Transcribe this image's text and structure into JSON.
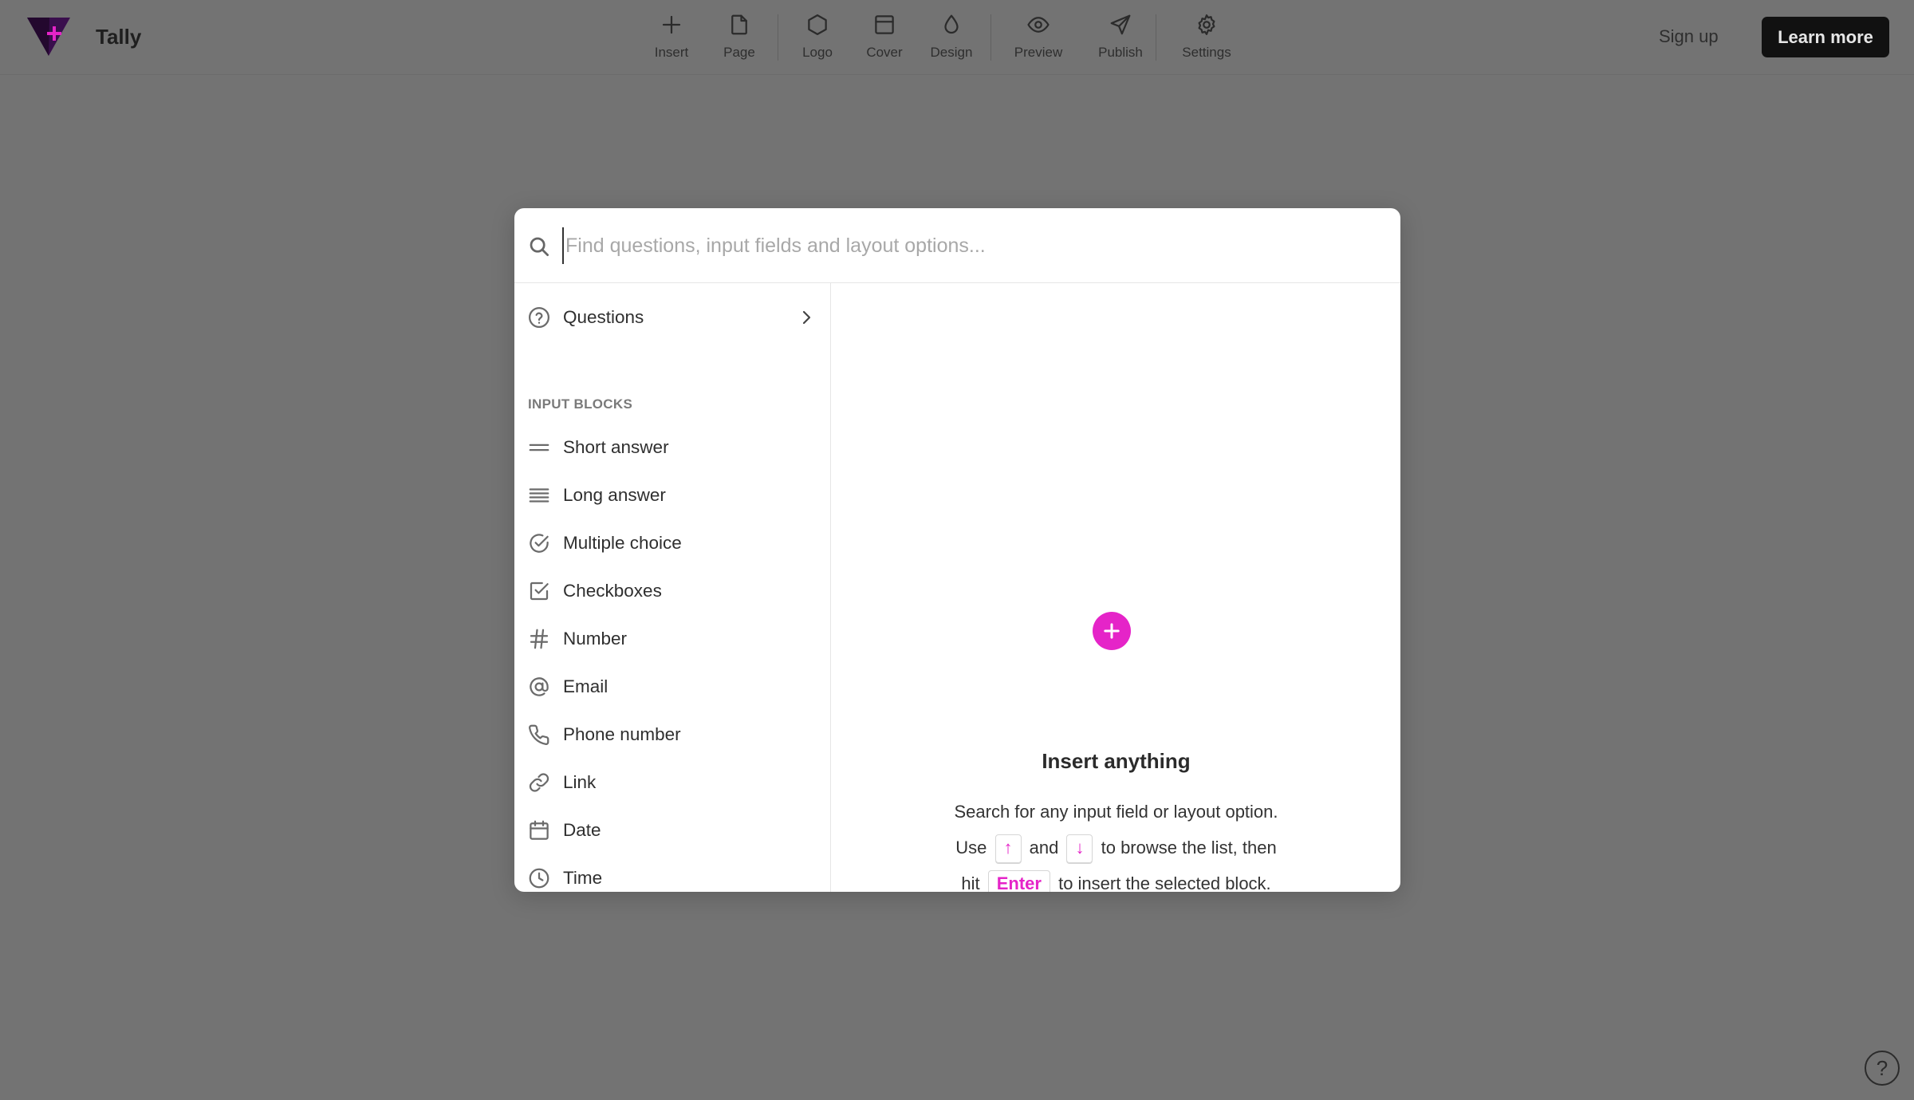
{
  "app": {
    "name": "Tally",
    "brand_colors": {
      "accent": "#e524c8",
      "logo_dark": "#3a0f4d"
    }
  },
  "toolbar": {
    "items": [
      {
        "label": "Insert",
        "icon": "plus-icon"
      },
      {
        "label": "Page",
        "icon": "page-icon"
      },
      {
        "label": "Logo",
        "icon": "hexagon-icon"
      },
      {
        "label": "Cover",
        "icon": "cover-icon"
      },
      {
        "label": "Design",
        "icon": "droplet-icon"
      },
      {
        "label": "Preview",
        "icon": "eye-icon"
      },
      {
        "label": "Publish",
        "icon": "send-icon"
      },
      {
        "label": "Settings",
        "icon": "gear-icon"
      }
    ]
  },
  "header": {
    "signup_label": "Sign up",
    "learn_more_label": "Learn more"
  },
  "modal": {
    "search": {
      "placeholder": "Find questions, input fields and layout options...",
      "value": ""
    },
    "questions_label": "Questions",
    "section_heading": "INPUT BLOCKS",
    "blocks": [
      {
        "label": "Short answer",
        "icon": "short-answer-icon"
      },
      {
        "label": "Long answer",
        "icon": "long-answer-icon"
      },
      {
        "label": "Multiple choice",
        "icon": "check-circle-icon"
      },
      {
        "label": "Checkboxes",
        "icon": "checkbox-icon"
      },
      {
        "label": "Number",
        "icon": "hash-icon"
      },
      {
        "label": "Email",
        "icon": "at-icon"
      },
      {
        "label": "Phone number",
        "icon": "phone-icon"
      },
      {
        "label": "Link",
        "icon": "link-icon"
      },
      {
        "label": "Date",
        "icon": "calendar-icon"
      },
      {
        "label": "Time",
        "icon": "clock-icon"
      }
    ],
    "info": {
      "title": "Insert anything",
      "line1": "Search for any input field or layout option.",
      "line2_pre": "Use",
      "key_up": "↑",
      "line2_mid": "and",
      "key_down": "↓",
      "line2_post": "to browse the list, then",
      "line3_pre": "hit",
      "key_enter": "Enter",
      "line3_post": "to insert the selected block."
    }
  },
  "help_label": "?"
}
